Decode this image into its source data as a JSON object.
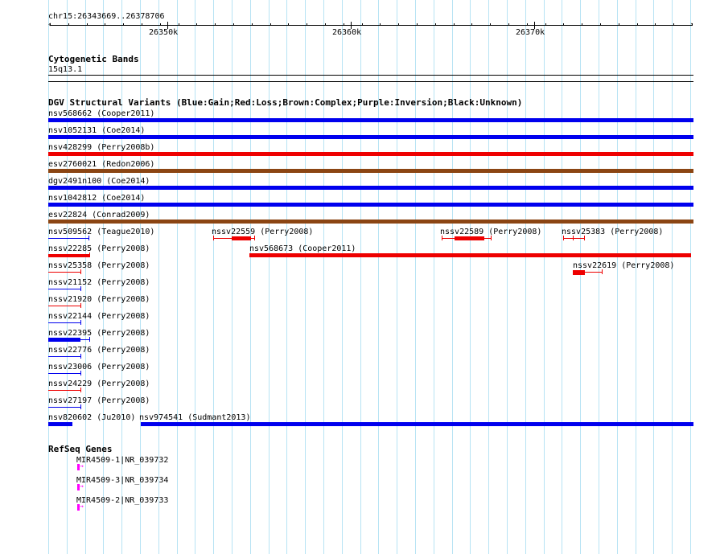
{
  "ruler": {
    "location": "chr15:26343669..26378706",
    "tick_labels": [
      "26350k",
      "26360k",
      "26370k"
    ]
  },
  "cyto": {
    "title": "Cytogenetic Bands",
    "band": "15q13.1"
  },
  "dgv": {
    "title": "DGV Structural Variants (Blue:Gain;Red:Loss;Brown:Complex;Purple:Inversion;Black:Unknown)",
    "colors": {
      "gain": "#0000ee",
      "loss": "#ee0000",
      "complex": "#8b4513"
    },
    "features": [
      {
        "label": "nsv568662 (Cooper2011)"
      },
      {
        "label": "nsv1052131 (Coe2014)"
      },
      {
        "label": "nsv428299 (Perry2008b)"
      },
      {
        "label": "esv2760021 (Redon2006)"
      },
      {
        "label": "dgv2491n100 (Coe2014)"
      },
      {
        "label": "nsv1042812 (Coe2014)"
      },
      {
        "label": "esv22824 (Conrad2009)"
      },
      {
        "label": "nsv509562 (Teague2010)"
      },
      {
        "label": "nssv22559 (Perry2008)"
      },
      {
        "label": "nssv22589 (Perry2008)"
      },
      {
        "label": "nssv25383 (Perry2008)"
      },
      {
        "label": "nssv22285 (Perry2008)"
      },
      {
        "label": "nsv568673 (Cooper2011)"
      },
      {
        "label": "nssv25358 (Perry2008)"
      },
      {
        "label": "nssv22619 (Perry2008)"
      },
      {
        "label": "nssv21152 (Perry2008)"
      },
      {
        "label": "nssv21920 (Perry2008)"
      },
      {
        "label": "nssv22144 (Perry2008)"
      },
      {
        "label": "nssv22395 (Perry2008)"
      },
      {
        "label": "nssv22776 (Perry2008)"
      },
      {
        "label": "nssv23006 (Perry2008)"
      },
      {
        "label": "nssv24229 (Perry2008)"
      },
      {
        "label": "nssv27197 (Perry2008)"
      },
      {
        "label": "nsv820602 (Ju2010)"
      },
      {
        "label": "nsv974541 (Sudmant2013)"
      }
    ]
  },
  "refseq": {
    "title": "RefSeq Genes",
    "color": "#ff00ff",
    "genes": [
      {
        "label": "MIR4509-1|NR_039732"
      },
      {
        "label": "MIR4509-3|NR_039734"
      },
      {
        "label": "MIR4509-2|NR_039733"
      }
    ]
  }
}
